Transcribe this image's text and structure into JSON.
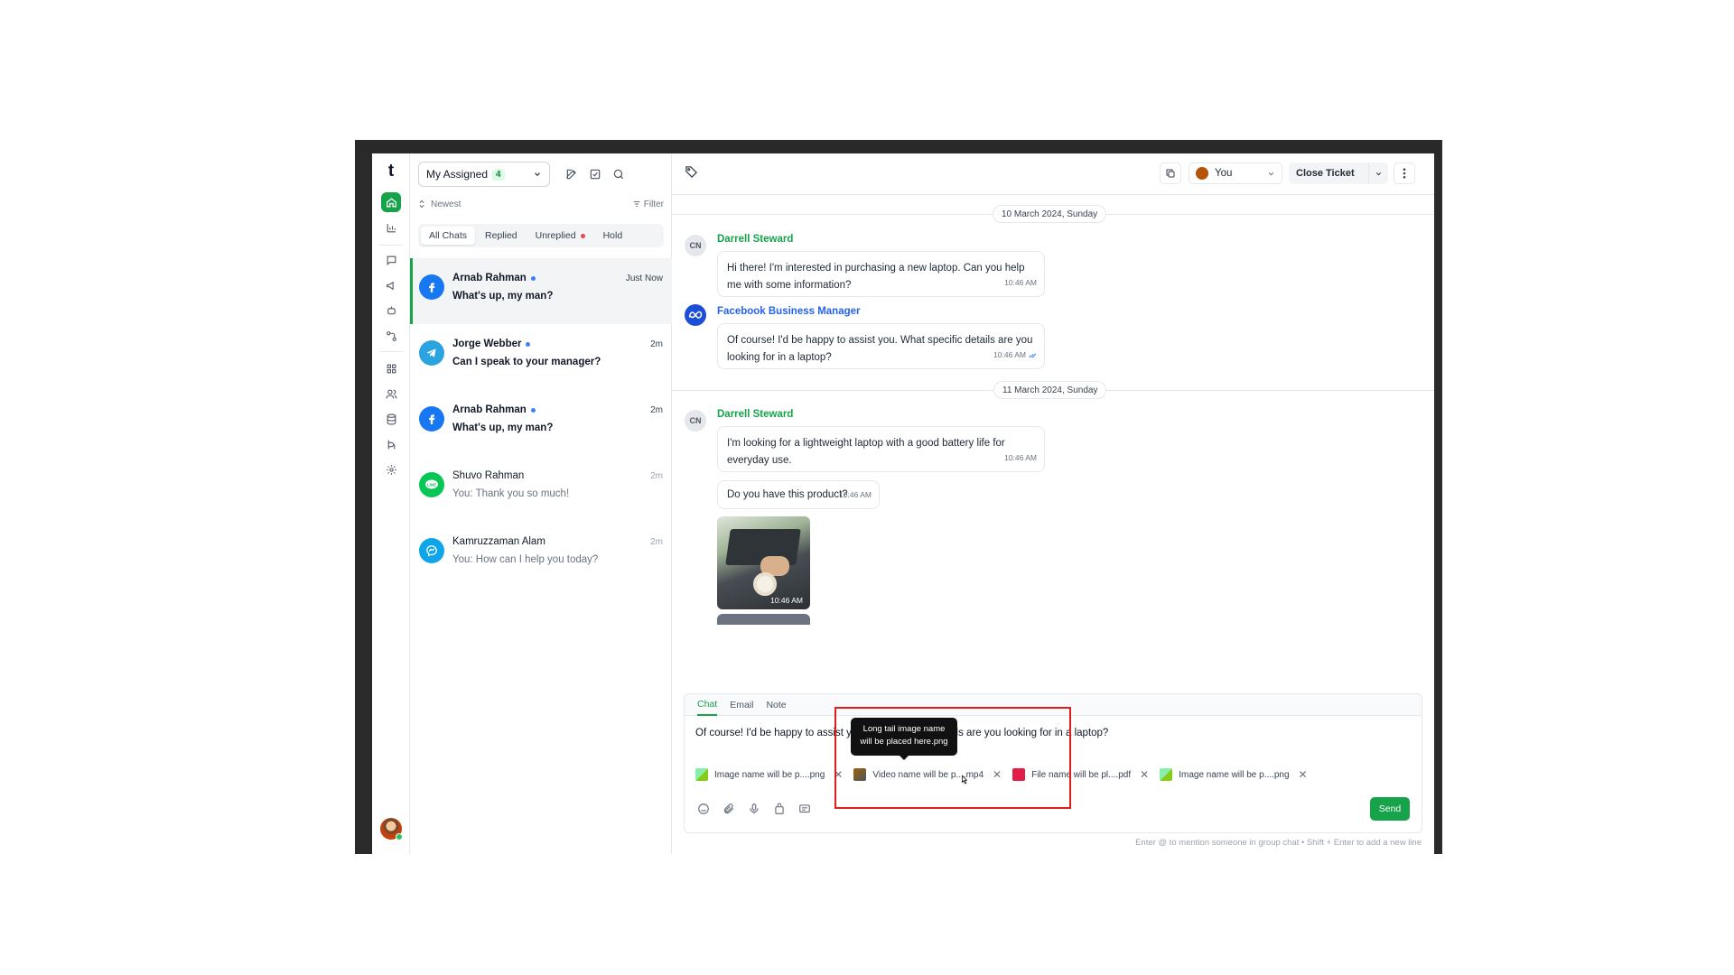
{
  "app": {
    "logo": "t"
  },
  "list": {
    "assign_label": "My Assigned",
    "assign_count": "4",
    "sort_label": "Newest",
    "filter_label": "Filter",
    "tabs": [
      "All Chats",
      "Replied",
      "Unreplied",
      "Hold"
    ],
    "conversations": [
      {
        "name": "Arnab Rahman",
        "time": "Just Now",
        "message": "What's up, my man?",
        "channel": "facebook"
      },
      {
        "name": "Jorge Webber",
        "time": "2m",
        "message": "Can I speak to your manager?",
        "channel": "telegram"
      },
      {
        "name": "Arnab Rahman",
        "time": "2m",
        "message": "What's up, my man?",
        "channel": "facebook"
      },
      {
        "name": "Shuvo Rahman",
        "time": "2m",
        "message": "You: Thank you so much!",
        "channel": "line"
      },
      {
        "name": "Kamruzzaman Alam",
        "time": "2m",
        "message": "You: How can I help you today?",
        "channel": "messenger"
      }
    ]
  },
  "topbar": {
    "assignee": "You",
    "close_ticket": "Close Ticket"
  },
  "thread": {
    "date1": "10 March 2024, Sunday",
    "date2": "11 March 2024, Sunday",
    "m1_initials": "CN",
    "m1_sender": "Darrell Steward",
    "m1_text": "Hi there! I'm interested in purchasing a new laptop. Can you help me with some information?",
    "m1_time": "10:46 AM",
    "m2_sender": "Facebook Business Manager",
    "m2_text": "Of course! I'd be happy to assist you. What specific details are you looking for in a laptop?",
    "m2_time": "10:46 AM",
    "m3_initials": "CN",
    "m3_sender": "Darrell Steward",
    "m3_text": "I'm looking for a lightweight laptop with a good battery life for everyday use.",
    "m3_time": "10:46 AM",
    "m4_text": "Do you have this product?",
    "m4_time": "10:46 AM",
    "photo_time": "10:46 AM"
  },
  "composer": {
    "tabs": [
      "Chat",
      "Email",
      "Note"
    ],
    "text": "Of course! I'd be happy to assist you. What specific details are you looking for in a laptop?",
    "tooltip": "Long tail image name will be placed here.png",
    "attachments": [
      "Image name will be p....png",
      "Video name will be p....mp4",
      "File name will be pl....pdf",
      "Image name will be p....png"
    ],
    "send": "Send",
    "hint": "Enter @ to mention someone in group chat • Shift + Enter to add a new line"
  },
  "colors": {
    "accent": "#16a34a",
    "highlight": "#e11d1d"
  }
}
